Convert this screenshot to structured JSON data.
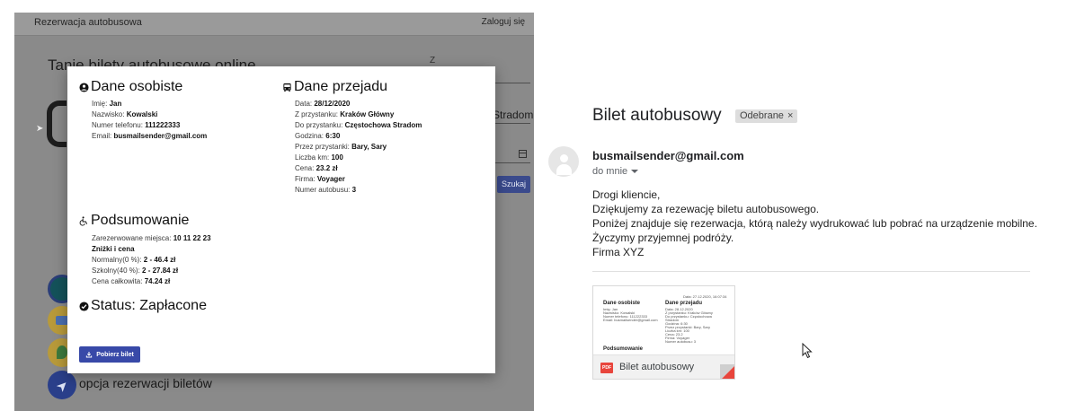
{
  "booking_app": {
    "title": "Rezerwacja autobusowa",
    "login": "Zaloguj się",
    "hero": "Tanie bilety autobusowe online",
    "from_label": "Z",
    "to_value_fragment": "Stradom",
    "search_button": "Szukaj",
    "feature_text": "opcja rezerwacji biletów"
  },
  "modal": {
    "personal": {
      "title": "Dane osobiste",
      "fields": [
        {
          "label": "Imię: ",
          "value": "Jan"
        },
        {
          "label": "Nazwisko: ",
          "value": "Kowalski"
        },
        {
          "label": "Numer telefonu: ",
          "value": "111222333"
        },
        {
          "label": "Email: ",
          "value": "busmailsender@gmail.com"
        }
      ]
    },
    "trip": {
      "title": "Dane przejadu",
      "fields": [
        {
          "label": "Data: ",
          "value": "28/12/2020"
        },
        {
          "label": "Z przystanku: ",
          "value": "Kraków Główny"
        },
        {
          "label": "Do przystanku: ",
          "value": "Częstochowa Stradom"
        },
        {
          "label": "Godzina: ",
          "value": "6:30"
        },
        {
          "label": "Przez przystanki: ",
          "value": "Bary, Sary"
        },
        {
          "label": "Liczba km: ",
          "value": "100"
        },
        {
          "label": "Cena: ",
          "value": "23.2 zł"
        },
        {
          "label": "Firma: ",
          "value": "Voyager"
        },
        {
          "label": "Numer autobusu: ",
          "value": "3"
        }
      ]
    },
    "summary": {
      "title": "Podsumowanie",
      "seats_label": "Zarezerwowane miejsca: ",
      "seats_value": "10 11 22 23",
      "discount_heading": "Zniżki i cena",
      "lines": [
        {
          "label": "Normalny(0 %): ",
          "value": "2 - 46.4 zł"
        },
        {
          "label": "Szkolny(40 %): ",
          "value": "2 - 27.84 zł"
        },
        {
          "label": "Cena całkowita: ",
          "value": "74.24 zł"
        }
      ]
    },
    "status": "Status: Zapłacone",
    "download_button": "Pobierz bilet"
  },
  "email": {
    "subject": "Bilet autobusowy",
    "label": "Odebrane",
    "label_close": "×",
    "sender": "busmailsender@gmail.com",
    "recipient": "do mnie",
    "body": [
      "Drogi kliencie,",
      "Dziękujemy za rezewację biletu autobusowego.",
      "Poniżej znajduje się rezerwacja, którą należy wydrukować lub pobrać na urządzenie mobilne.",
      "Życzymy przyjemnej podróży.",
      "Firma XYZ"
    ],
    "attachment": {
      "file_type": "PDF",
      "name": "Bilet autobusowy",
      "preview": {
        "timestamp": "Data: 27.12.2020, 16:07:34",
        "personal_title": "Dane osobiste",
        "personal_lines": [
          "Imię: Jan",
          "Nazwisko: Kowalski",
          "Numer telefonu: 111222333",
          "Email: busmailsender@gmail.com"
        ],
        "trip_title": "Dane przejadu",
        "trip_lines": [
          "Data: 28.12.2020",
          "Z przystanku: Kraków Główny",
          "Do przystanku: Częstochowa",
          "Stradom",
          "Godzina: 6:30",
          "Przez przystanki: Bary, Sary",
          "Liczba km: 100",
          "Cena: 23.2",
          "Firma: Voyager",
          "Numer autobusu: 3"
        ],
        "summary_title": "Podsumowanie"
      }
    }
  },
  "icons": {
    "personal": "account-circle-icon",
    "trip": "bus-icon",
    "summary": "accessible-icon",
    "status": "check-circle-icon",
    "download": "download-icon",
    "avatar": "person-icon",
    "attachment": "pdf-icon"
  },
  "colors": {
    "primary_button": "#3849a8",
    "overlay_bg": "#8a8a8a",
    "pdf_red": "#e8453c"
  }
}
